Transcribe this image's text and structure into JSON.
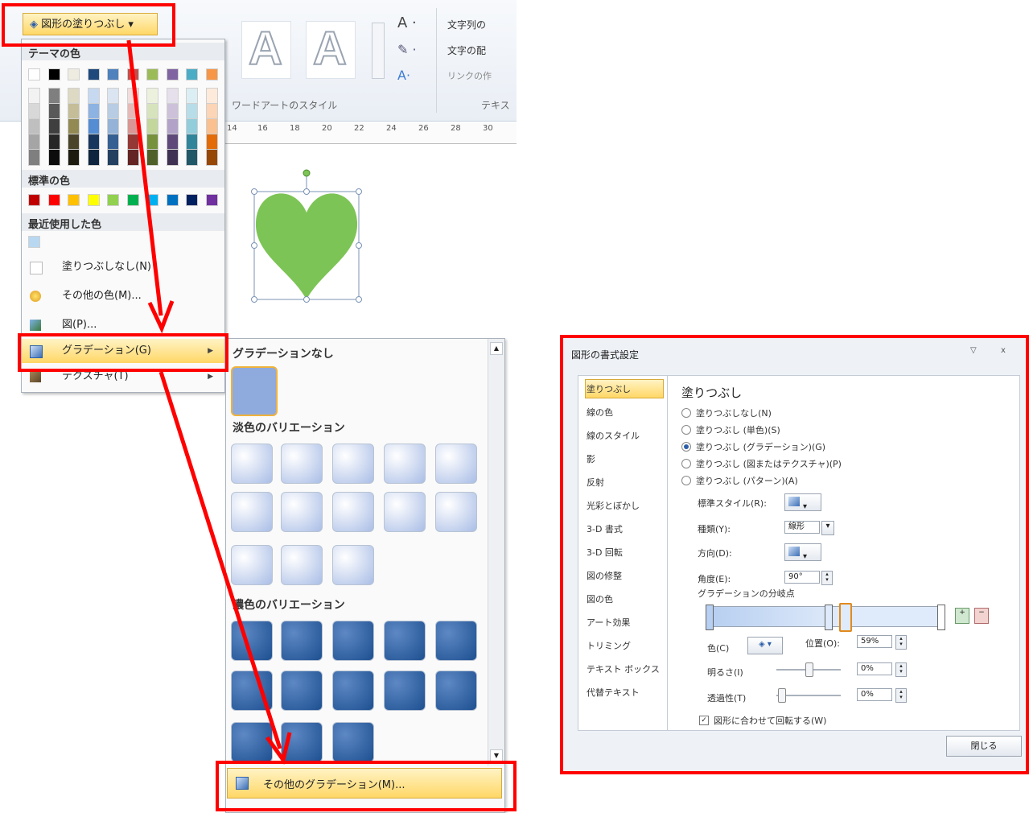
{
  "ribbon": {
    "shape_fill_label": "図形の塗りつぶし ▾",
    "wordart_styles_label": "ワードアートのスタイル",
    "text_direction_label": "文字列の",
    "text_align_label": "文字の配",
    "link_label": "リンクの作",
    "text_group_label": "テキス",
    "ruler_ticks": [
      "14",
      "16",
      "18",
      "20",
      "22",
      "24",
      "26",
      "28",
      "30"
    ]
  },
  "menu": {
    "theme_colors_title": "テーマの色",
    "standard_colors_title": "標準の色",
    "recent_colors_title": "最近使用した色",
    "no_fill": "塗りつぶしなし(N)",
    "more_colors": "その他の色(M)...",
    "picture": "図(P)...",
    "gradient": "グラデーション(G)",
    "texture": "テクスチャ(T)",
    "theme_top_row": [
      "#ffffff",
      "#000000",
      "#eeece1",
      "#1f497d",
      "#4f81bd",
      "#c0504d",
      "#9bbb59",
      "#8064a2",
      "#4bacc6",
      "#f79646"
    ],
    "theme_columns": [
      [
        "#f2f2f2",
        "#d8d8d8",
        "#bfbfbf",
        "#a5a5a5",
        "#7f7f7f"
      ],
      [
        "#7f7f7f",
        "#595959",
        "#3f3f3f",
        "#262626",
        "#0c0c0c"
      ],
      [
        "#ddd9c3",
        "#c4bd97",
        "#938953",
        "#494429",
        "#1d1b10"
      ],
      [
        "#c6d9f0",
        "#8db3e2",
        "#548dd4",
        "#17365d",
        "#0f243e"
      ],
      [
        "#dbe5f1",
        "#b8cce4",
        "#95b3d7",
        "#366092",
        "#244061"
      ],
      [
        "#f2dcdb",
        "#e5b9b7",
        "#d99694",
        "#953734",
        "#632423"
      ],
      [
        "#ebf1dd",
        "#d7e3bc",
        "#c3d69b",
        "#76923c",
        "#4f6128"
      ],
      [
        "#e5e0ec",
        "#ccc1d9",
        "#b2a2c7",
        "#5f497a",
        "#3f3151"
      ],
      [
        "#dbeef3",
        "#b7dde8",
        "#92cddc",
        "#31859b",
        "#205867"
      ],
      [
        "#fdeada",
        "#fbd5b5",
        "#fac08f",
        "#e36c09",
        "#974806"
      ]
    ],
    "standard": [
      "#c00000",
      "#ff0000",
      "#ffc000",
      "#ffff00",
      "#92d050",
      "#00b050",
      "#00b0f0",
      "#0070c0",
      "#002060",
      "#7030a0"
    ],
    "recent": [
      "#b8d8f2"
    ]
  },
  "submenu": {
    "no_gradient": "グラデーションなし",
    "light_variations": "淡色のバリエーション",
    "dark_variations": "濃色のバリエーション",
    "more_gradients": "その他のグラデーション(M)..."
  },
  "dialog": {
    "title": "図形の書式設定",
    "nav": [
      "塗りつぶし",
      "線の色",
      "線のスタイル",
      "影",
      "反射",
      "光彩とぼかし",
      "3-D 書式",
      "3-D 回転",
      "図の修整",
      "図の色",
      "アート効果",
      "トリミング",
      "テキスト ボックス",
      "代替テキスト"
    ],
    "section_title": "塗りつぶし",
    "options": [
      "塗りつぶしなし(N)",
      "塗りつぶし (単色)(S)",
      "塗りつぶし (グラデーション)(G)",
      "塗りつぶし (図またはテクスチャ)(P)",
      "塗りつぶし (パターン)(A)"
    ],
    "preset_label": "標準スタイル(R):",
    "type_label": "種類(Y):",
    "type_value": "線形",
    "direction_label": "方向(D):",
    "angle_label": "角度(E):",
    "angle_value": "90°",
    "stops_label": "グラデーションの分岐点",
    "color_label": "色(C)",
    "position_label": "位置(O):",
    "position_value": "59%",
    "brightness_label": "明るさ(I)",
    "brightness_value": "0%",
    "transparency_label": "透過性(T)",
    "transparency_value": "0%",
    "rotate_label": "図形に合わせて回転する(W)",
    "close_label": "閉じる",
    "pin_icon": "▽",
    "close_icon": "x"
  },
  "shape": {
    "fill": "#7dc456"
  },
  "colors": {
    "highlight": "#ff0000",
    "menu_hover": "#ffd766"
  }
}
